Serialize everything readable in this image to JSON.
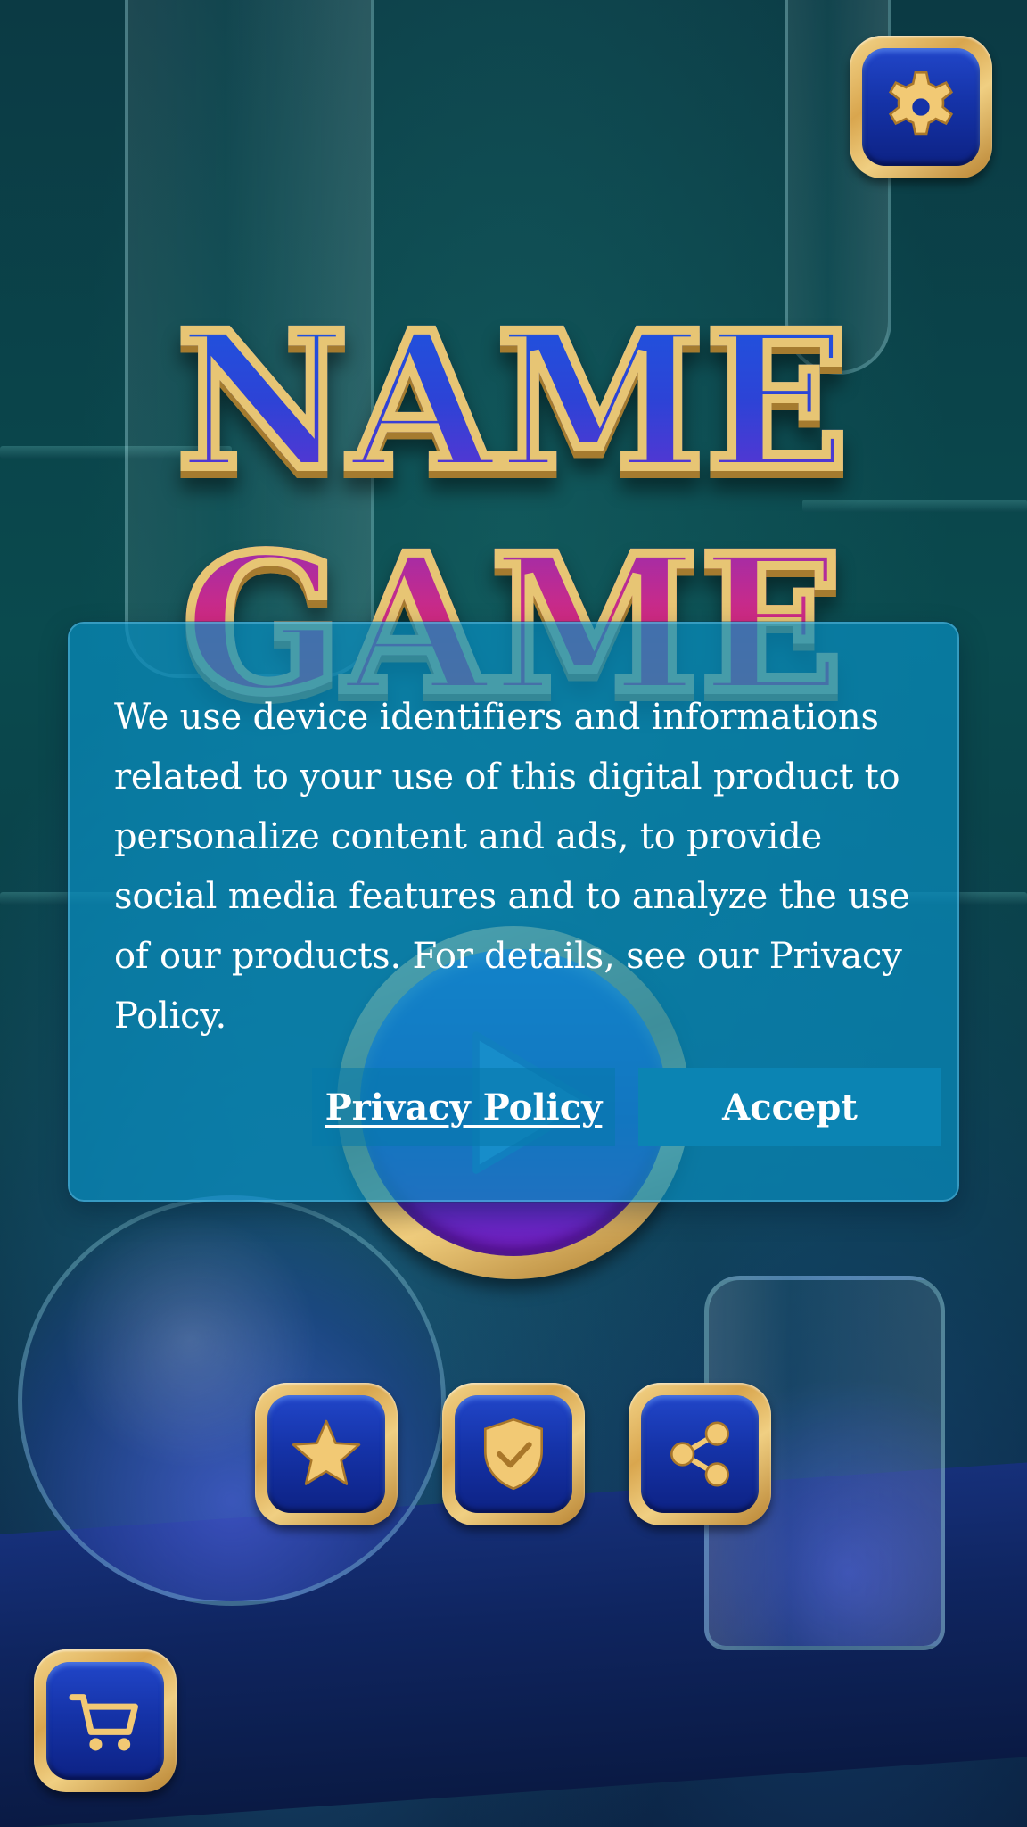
{
  "game": {
    "title_line_1": "NAME",
    "title_line_2": "GAME"
  },
  "consent_dialog": {
    "message": "We use device identifiers and informations related to your use of this digital product to personalize content and ads, to provide social media features and to analyze the use of our products. For details, see our Privacy Policy.",
    "privacy_policy_label": "Privacy Policy",
    "accept_label": "Accept"
  },
  "icons": {
    "settings": "gear-icon",
    "play": "play-icon",
    "rate": "star-icon",
    "privacy": "shield-check-icon",
    "share": "share-icon",
    "shop": "cart-icon"
  },
  "colors": {
    "gold_frame": "#e7c574",
    "button_blue": "#1533a8",
    "dialog_bg": "#088cbe",
    "accept_button": "#0b84b3",
    "title_blue": "#2d43d6",
    "title_pink": "#d42a80"
  }
}
